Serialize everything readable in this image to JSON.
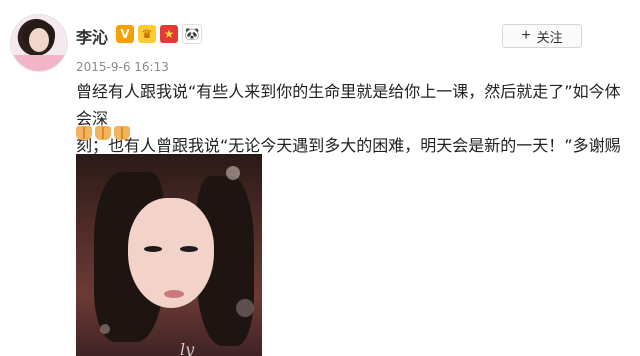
{
  "header": {
    "username": "李沁",
    "follow_label": "关注",
    "timestamp": "2015-9-6 16:13"
  },
  "icons": {
    "verified": "v-badge-icon",
    "crown": "crown-icon",
    "flag": "china-flag-icon",
    "panda": "panda-icon",
    "plus": "plus-icon",
    "hands": "praying-hands-icon"
  },
  "post": {
    "line1": "曾经有人跟我说“有些人来到你的生命里就是给你上一课，然后就走了”如今体会深",
    "line2": "刻；也有人曾跟我说“无论今天遇到多大的困难，明天会是新的一天！”多谢赐教"
  },
  "badges": {
    "v": "V",
    "gold": "♛",
    "red": "★",
    "panda": "🐼"
  },
  "colors": {
    "accent_gold": "#f7a100",
    "text_dark": "#222222",
    "muted": "#8a8a8a"
  },
  "photo": {
    "signature_glyph": "ly"
  }
}
